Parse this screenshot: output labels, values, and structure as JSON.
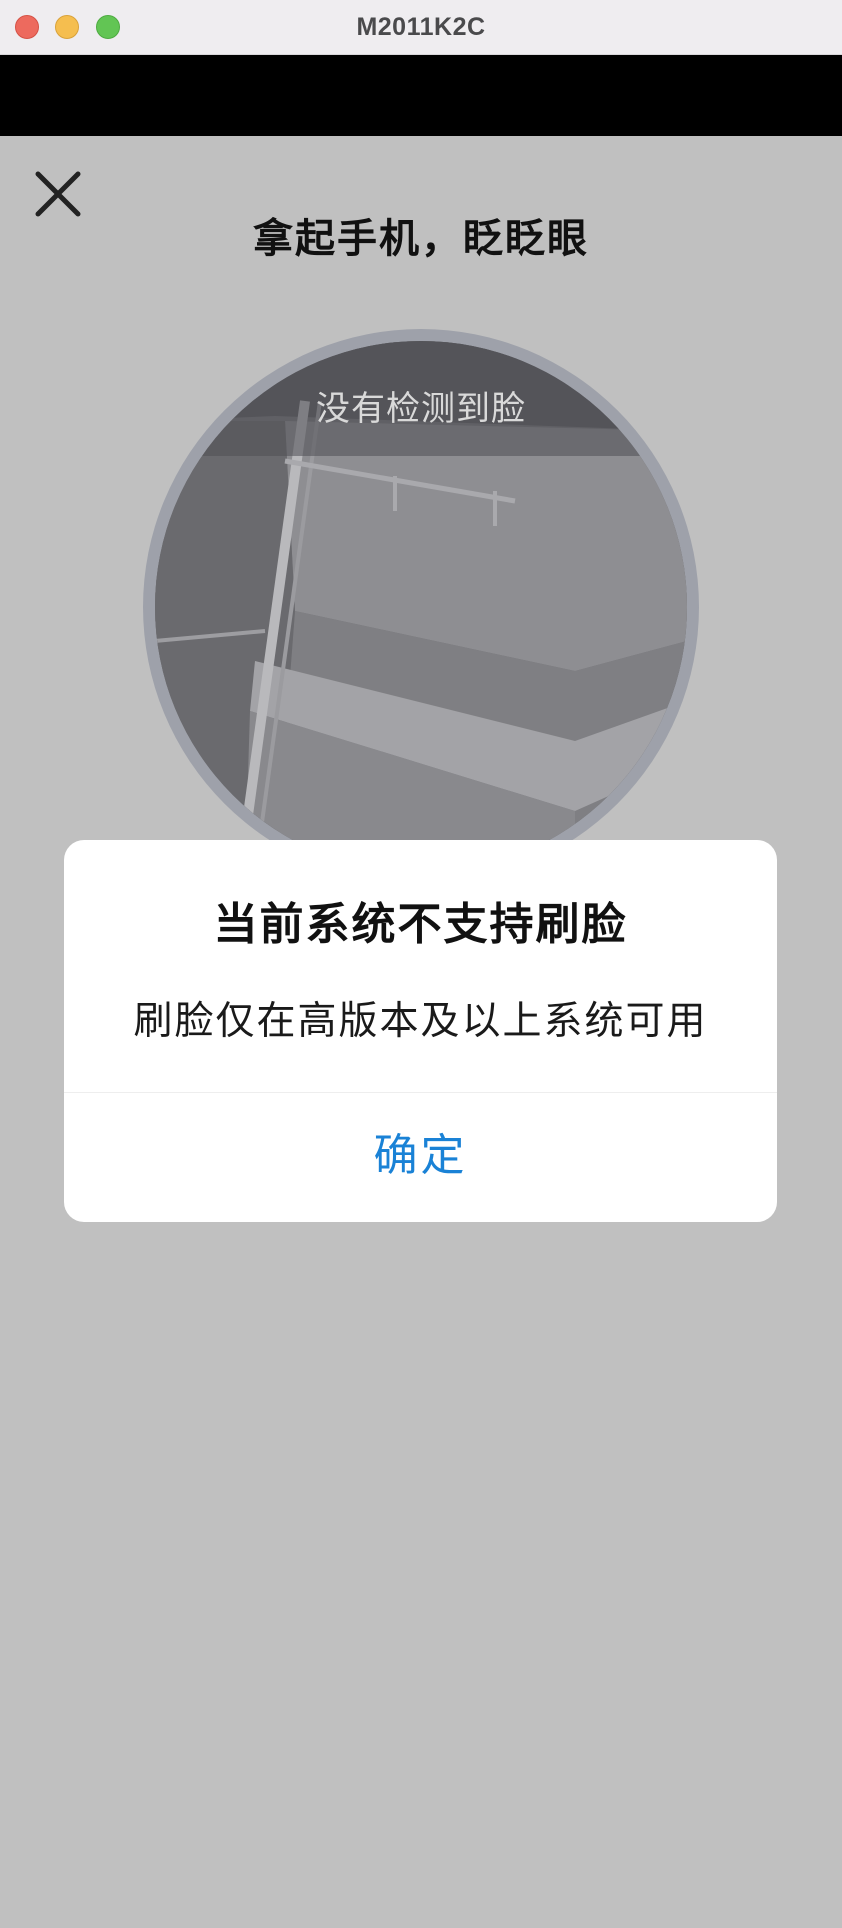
{
  "window": {
    "title": "M2011K2C"
  },
  "face_verify": {
    "close_icon": "close-icon",
    "prompt": "拿起手机，眨眨眼",
    "detect_status": "没有检测到脸"
  },
  "dialog": {
    "title": "当前系统不支持刷脸",
    "message": "刷脸仅在高版本及以上系统可用",
    "confirm_label": "确定"
  },
  "colors": {
    "screen_bg": "#c0c0c0",
    "accent": "#1a82d6",
    "titlebar_bg": "#efedf0"
  }
}
